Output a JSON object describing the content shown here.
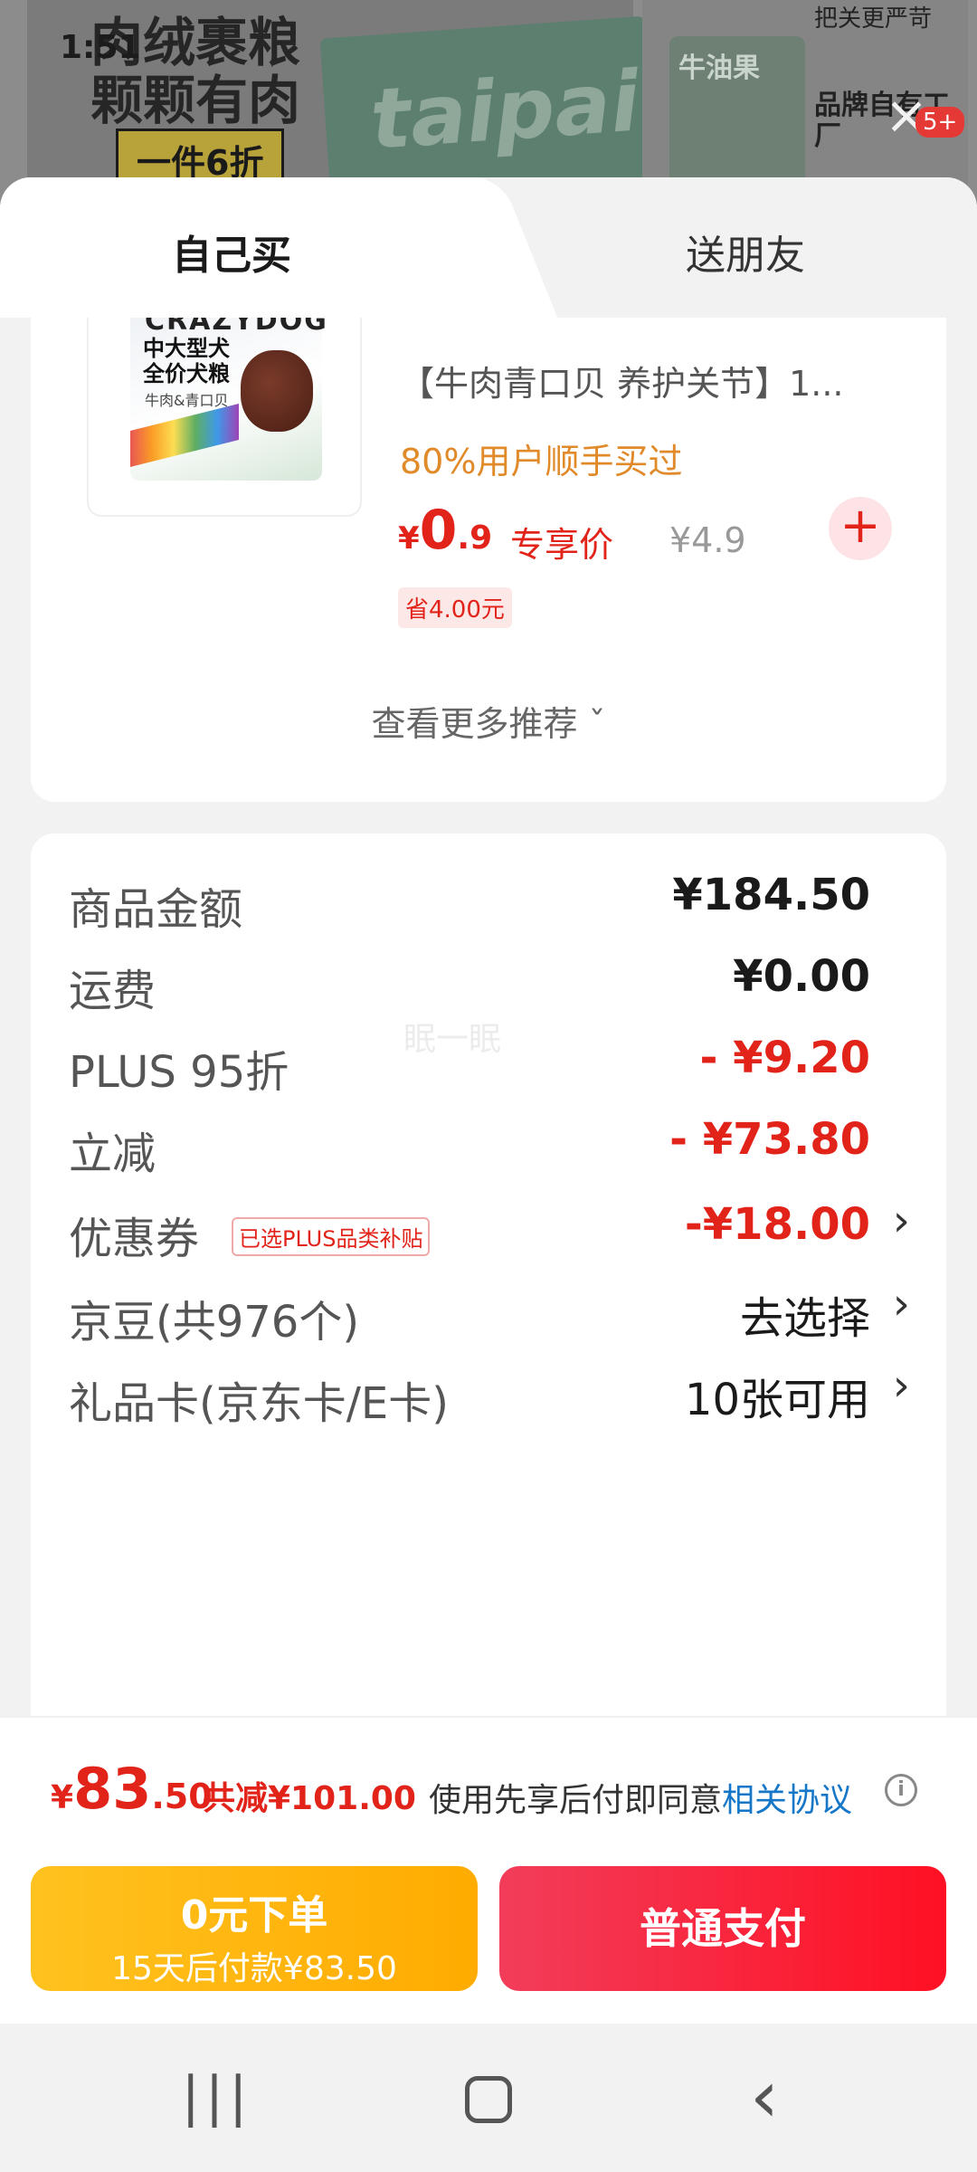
{
  "status_bar": {
    "time": "1:51"
  },
  "background_page": {
    "banner_line1": "肉绒裹粮",
    "banner_line2": "颗颗有肉",
    "banner_deal": "一件6折",
    "bag_text": "taipai",
    "side_product": "牛油果",
    "side_top": "把关更严苛",
    "side_text": "品牌自有工厂",
    "badge": "5+"
  },
  "tabs": {
    "self": "自己买",
    "friend": "送朋友"
  },
  "recommend": {
    "image_brand": "CRAZYDOG",
    "image_line1": "中大型犬",
    "image_line2": "全价犬粮",
    "image_line3": "牛肉&青口贝",
    "title": "【牛肉青口贝 养护关节】1...",
    "bought": "80%用户顺手买过",
    "price_currency": "¥",
    "price_int": "0",
    "price_dec": ".9",
    "exclusive_label": "专享价",
    "original_price": "¥4.9",
    "save_tag": "省4.00元",
    "add_icon": "plus-icon",
    "more_label": "查看更多推荐 ˇ"
  },
  "details": {
    "watermark": "眠一眠",
    "rows": [
      {
        "label": "商品金额",
        "value": "¥184.50"
      },
      {
        "label": "运费",
        "value": "¥0.00"
      },
      {
        "label": "PLUS 95折",
        "value": "- ¥9.20"
      },
      {
        "label": "立减",
        "value": "- ¥73.80"
      },
      {
        "label": "优惠券",
        "tag": "已选PLUS品类补贴",
        "value": "-¥18.00"
      },
      {
        "label": "京豆(共976个)",
        "value": "去选择"
      },
      {
        "label": "礼品卡(京东卡/E卡)",
        "value": "10张可用"
      }
    ],
    "chevron": "›"
  },
  "summary": {
    "currency": "¥",
    "total_int": "83",
    "total_dec": ".50",
    "saved": "共减¥101.00",
    "agree_text": "使用先享后付即同意",
    "agree_link": "相关协议",
    "info_icon": "i"
  },
  "actions": {
    "later_title": "0元下单",
    "later_sub": "15天后付款¥83.50",
    "pay": "普通支付"
  },
  "navbar": {
    "recent": "|||",
    "back": "‹"
  },
  "colors": {
    "accent_red": "#e2231a",
    "orange": "#e08a2a",
    "yellow_button": "#ffc21f",
    "red_button": "#f23d5a",
    "link_blue": "#1677c8"
  }
}
